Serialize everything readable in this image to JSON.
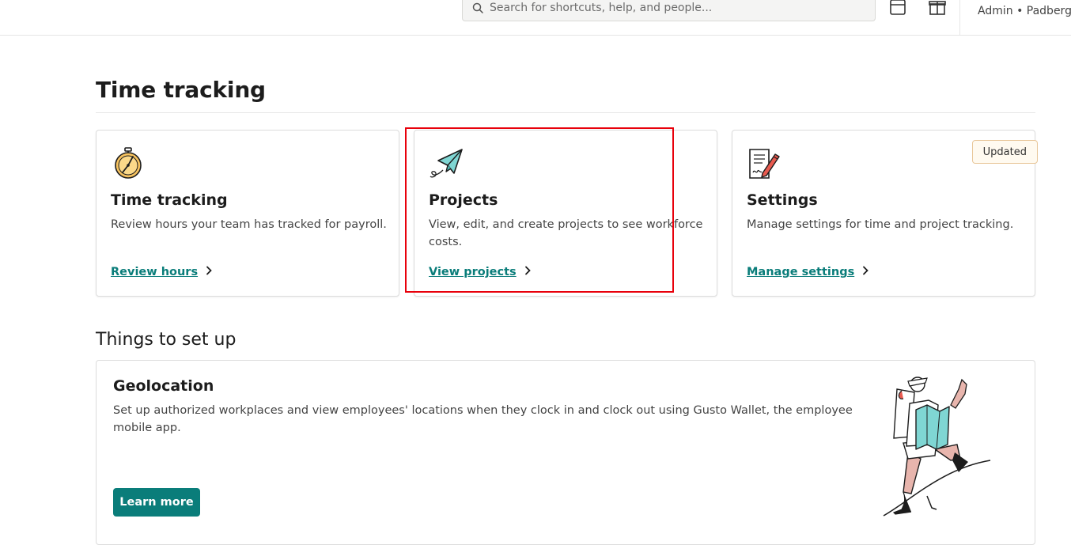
{
  "topbar": {
    "search_placeholder": "Search for shortcuts, help, and people...",
    "account_label": "Admin • Padberg"
  },
  "page": {
    "title": "Time tracking"
  },
  "cards": [
    {
      "title": "Time tracking",
      "description": "Review hours your team has tracked for payroll.",
      "link": "Review hours",
      "icon": "stopwatch-icon"
    },
    {
      "title": "Projects",
      "description": "View, edit, and create projects to see workforce costs.",
      "link": "View projects",
      "icon": "paper-plane-icon"
    },
    {
      "title": "Settings",
      "description": "Manage settings for time and project tracking.",
      "link": "Manage settings",
      "icon": "document-pen-icon",
      "badge": "Updated"
    }
  ],
  "setup": {
    "section_title": "Things to set up",
    "item": {
      "title": "Geolocation",
      "description": "Set up authorized workplaces and view employees' locations when they clock in and clock out using Gusto Wallet, the employee mobile app.",
      "button": "Learn more",
      "illustration": "hiker-with-map-illustration"
    }
  },
  "colors": {
    "accent": "#0a7d7a",
    "highlight_box": "#e8000b",
    "badge_border": "#e8c79a"
  }
}
